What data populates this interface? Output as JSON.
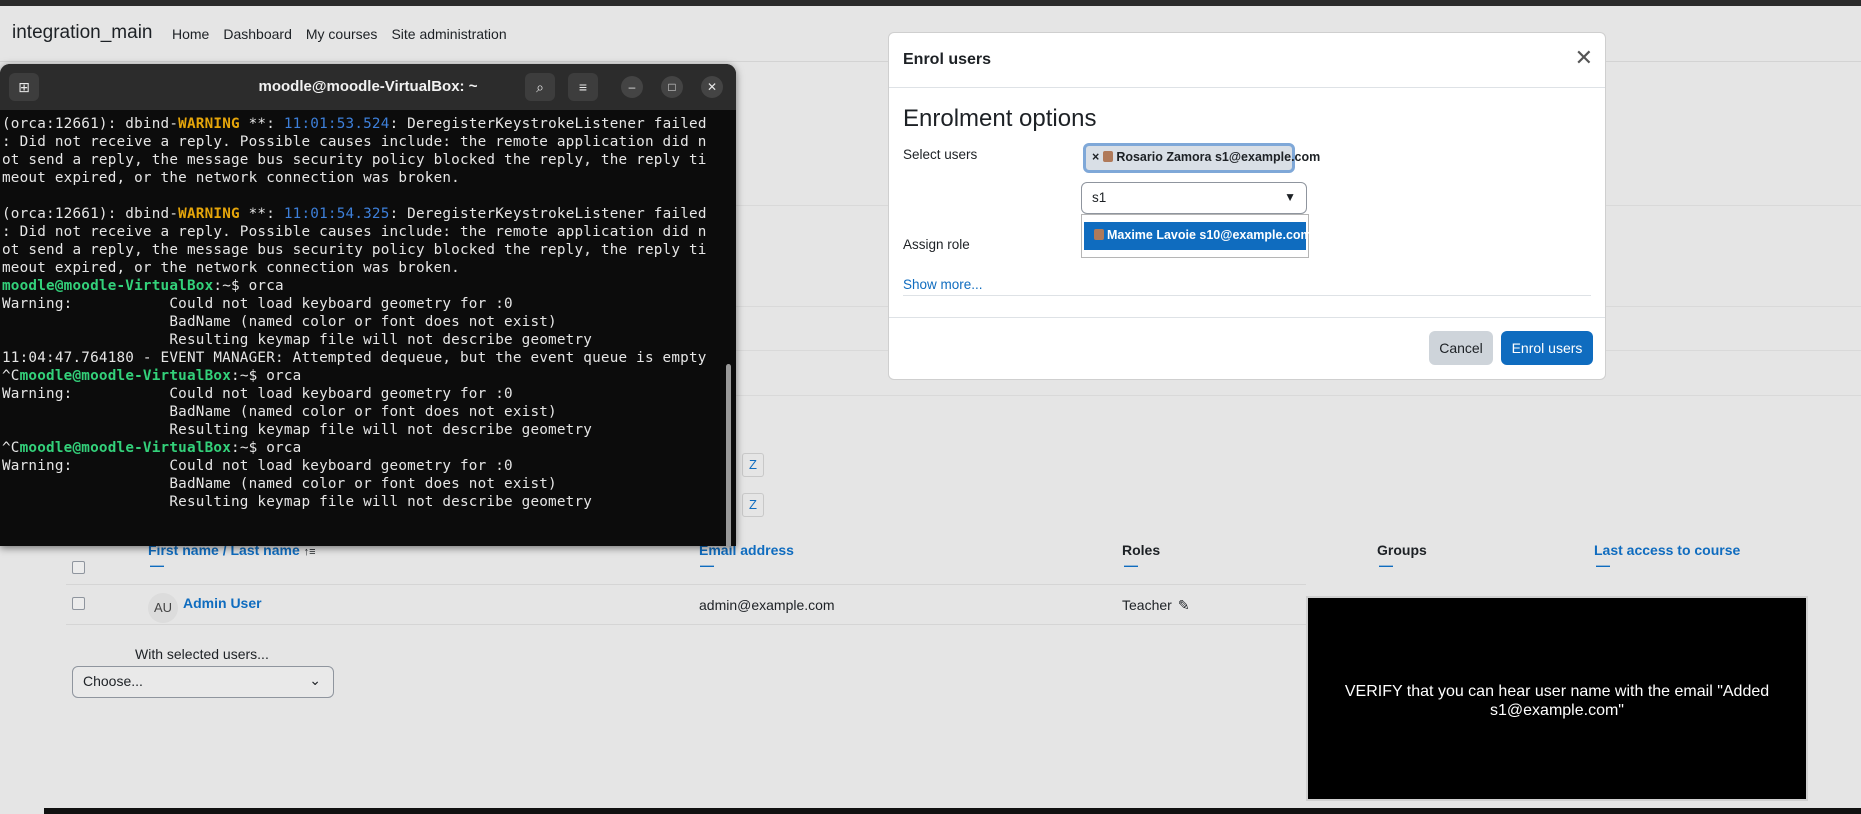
{
  "navbar": {
    "brand": "integration_main",
    "links": [
      "Home",
      "Dashboard",
      "My courses",
      "Site administration"
    ]
  },
  "terminal": {
    "title": "moodle@moodle-VirtualBox: ~",
    "lines": [
      [
        {
          "t": "(orca:12661): dbind-"
        },
        {
          "t": "WARNING",
          "c": "warn"
        },
        {
          "t": " **: "
        },
        {
          "t": "11:01:53.524",
          "c": "tstamp"
        },
        {
          "t": ": DeregisterKeystrokeListener failed"
        }
      ],
      [
        {
          "t": ": Did not receive a reply. Possible causes include: the remote application did n"
        }
      ],
      [
        {
          "t": "ot send a reply, the message bus security policy blocked the reply, the reply ti"
        }
      ],
      [
        {
          "t": "meout expired, or the network connection was broken."
        }
      ],
      [
        {
          "t": ""
        }
      ],
      [
        {
          "t": "(orca:12661): dbind-"
        },
        {
          "t": "WARNING",
          "c": "warn"
        },
        {
          "t": " **: "
        },
        {
          "t": "11:01:54.325",
          "c": "tstamp"
        },
        {
          "t": ": DeregisterKeystrokeListener failed"
        }
      ],
      [
        {
          "t": ": Did not receive a reply. Possible causes include: the remote application did n"
        }
      ],
      [
        {
          "t": "ot send a reply, the message bus security policy blocked the reply, the reply ti"
        }
      ],
      [
        {
          "t": "meout expired, or the network connection was broken."
        }
      ],
      [
        {
          "t": "moodle@moodle-VirtualBox",
          "c": "prompt"
        },
        {
          "t": ":~$ orca"
        }
      ],
      [
        {
          "t": "Warning:           Could not load keyboard geometry for :0"
        }
      ],
      [
        {
          "t": "                   BadName (named color or font does not exist)"
        }
      ],
      [
        {
          "t": "                   Resulting keymap file will not describe geometry"
        }
      ],
      [
        {
          "t": "11:04:47.764180 - EVENT MANAGER: Attempted dequeue, but the event queue is empty"
        }
      ],
      [
        {
          "t": "^C"
        },
        {
          "t": "moodle@moodle-VirtualBox",
          "c": "prompt"
        },
        {
          "t": ":~$ orca"
        }
      ],
      [
        {
          "t": "Warning:           Could not load keyboard geometry for :0"
        }
      ],
      [
        {
          "t": "                   BadName (named color or font does not exist)"
        }
      ],
      [
        {
          "t": "                   Resulting keymap file will not describe geometry"
        }
      ],
      [
        {
          "t": "^C"
        },
        {
          "t": "moodle@moodle-VirtualBox",
          "c": "prompt"
        },
        {
          "t": ":~$ orca"
        }
      ],
      [
        {
          "t": "Warning:           Could not load keyboard geometry for :0"
        }
      ],
      [
        {
          "t": "                   BadName (named color or font does not exist)"
        }
      ],
      [
        {
          "t": "                   Resulting keymap file will not describe geometry"
        }
      ]
    ],
    "icons": {
      "new_tab": "new-tab-icon",
      "search": "search-icon",
      "menu": "hamburger-menu-icon",
      "minimize": "minimize-icon",
      "maximize": "maximize-icon",
      "close": "close-icon"
    }
  },
  "page": {
    "letter_buttons": [
      "Z",
      "Z"
    ],
    "table": {
      "headers": {
        "first_name": "First name",
        "separator": " / ",
        "last_name": "Last name",
        "email": "Email address",
        "roles": "Roles",
        "groups": "Groups",
        "last_access": "Last access to course"
      },
      "row": {
        "avatar": "AU",
        "name": "Admin User",
        "email": "admin@example.com",
        "role": "Teacher"
      }
    },
    "with_selected": "With selected users...",
    "choose": "Choose..."
  },
  "modal": {
    "title": "Enrol users",
    "section_title": "Enrolment options",
    "select_users_label": "Select users",
    "selected_chip": "Rosario Zamora s1@example.com",
    "search_value": "s1",
    "suggestion": "Maxime Lavoie s10@example.com",
    "assign_role_label": "Assign role",
    "show_more": "Show more...",
    "cancel": "Cancel",
    "enrol": "Enrol users"
  },
  "verify": {
    "text": "VERIFY that you can hear user name with the email \"Added s1@example.com\""
  },
  "colors": {
    "primary": "#0f6cbf",
    "warning": "#e5a50a",
    "prompt": "#33d17a",
    "timestamp": "#3d7fd9"
  }
}
